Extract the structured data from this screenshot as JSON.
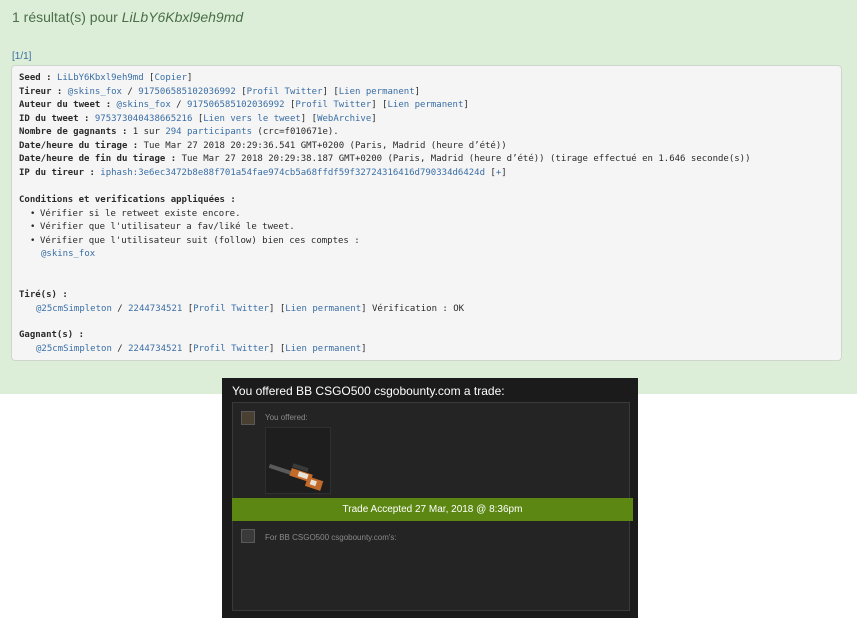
{
  "header": {
    "prefix": "1 résultat(s) pour ",
    "seed": "LiLbY6Kbxl9eh9md"
  },
  "pagination": "[1/1]",
  "result": {
    "seed": {
      "label": "Seed : ",
      "value": "LiLbY6Kbxl9eh9md",
      "copy": "Copier"
    },
    "tireur": {
      "label": "Tireur : ",
      "handle": "@skins_fox",
      "sep": " / ",
      "id": "917506585102036992",
      "profil": "Profil Twitter",
      "perma": "Lien permanent"
    },
    "auteur": {
      "label": "Auteur du tweet : ",
      "handle": "@skins_fox",
      "sep": " / ",
      "id": "917506585102036992",
      "profil": "Profil Twitter",
      "perma": "Lien permanent"
    },
    "tweet": {
      "label": "ID du tweet : ",
      "id": "975373040438665216",
      "link": "Lien vers le tweet",
      "archive": "WebArchive"
    },
    "gagnants": {
      "label": "Nombre de gagnants : ",
      "pre": "1 sur ",
      "participants": "294 participants",
      "crc": " (crc=f010671e)."
    },
    "date_start": {
      "label": "Date/heure du tirage : ",
      "value": "Tue Mar 27 2018 20:29:36.541 GMT+0200 (Paris, Madrid (heure d’été))"
    },
    "date_end": {
      "label": "Date/heure de fin du tirage : ",
      "value": "Tue Mar 27 2018 20:29:38.187 GMT+0200 (Paris, Madrid (heure d’été)) (tirage effectué en 1.646 seconde(s))"
    },
    "ip": {
      "label": "IP du tireur : ",
      "value": "iphash:3e6ec3472b8e88f701a54fae974cb5a68ffdf59f32724316416d790334d6424d",
      "plus": "+"
    },
    "conditions": {
      "title": "Conditions et verifications appliquées :",
      "items": [
        "Vérifier si le retweet existe encore.",
        "Vérifier que l'utilisateur a fav/liké le tweet.",
        "Vérifier que l'utilisateur suit (follow) bien ces comptes :"
      ],
      "account": "@skins_fox"
    },
    "tires": {
      "label": "Tiré(s) :",
      "handle": "@25cmSimpleton",
      "sep": " / ",
      "id": "2244734521",
      "profil": "Profil Twitter",
      "perma": "Lien permanent",
      "verif": " Vérification : OK"
    },
    "winners": {
      "label": "Gagnant(s) :",
      "handle": "@25cmSimpleton",
      "sep": " / ",
      "id": "2244734521",
      "profil": "Profil Twitter",
      "perma": "Lien permanent"
    }
  },
  "trade": {
    "title": "You offered BB CSGO500 csgobounty.com a trade:",
    "offered_label": "You offered:",
    "accepted": "Trade Accepted 27 Mar, 2018 @ 8:36pm",
    "for_label": "For BB CSGO500 csgobounty.com's:",
    "item_icon": "awp-rifle-icon"
  },
  "colors": {
    "page_bg": "#ddeed8",
    "link": "#3a6ea5",
    "accept_bg": "#5b8712",
    "trade_bg": "#1b1b1b"
  }
}
